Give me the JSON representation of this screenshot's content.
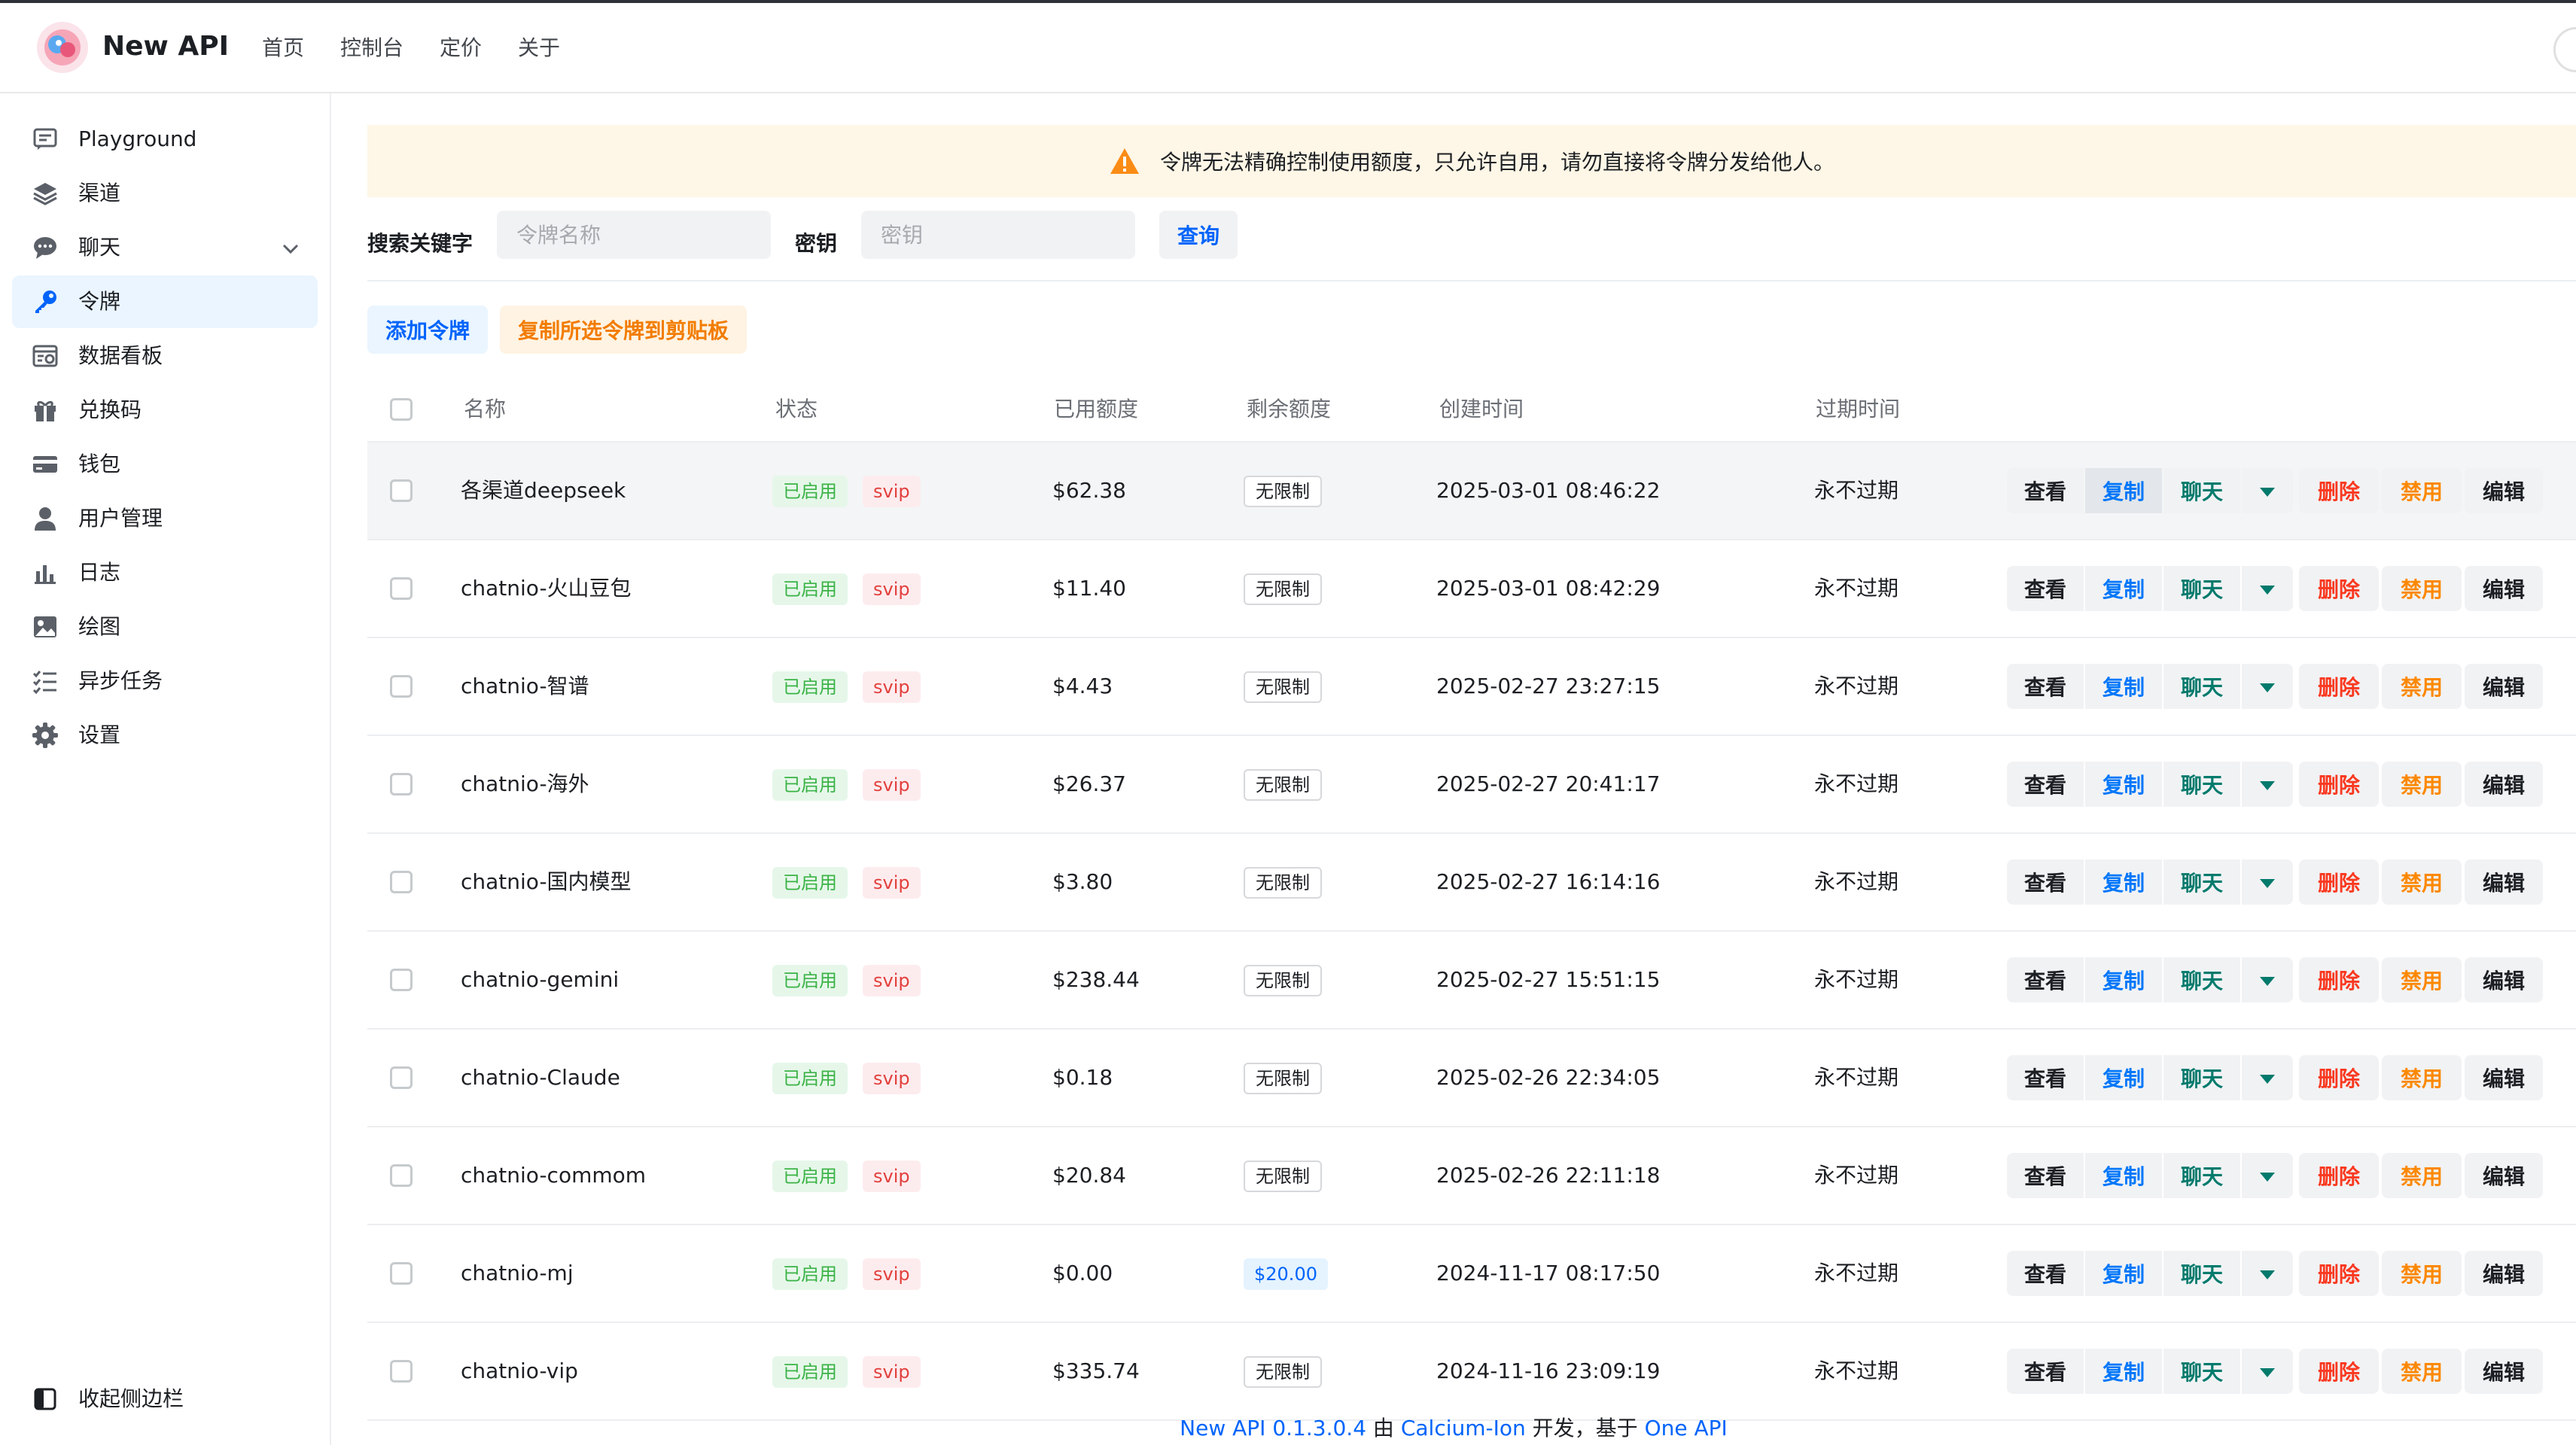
{
  "header": {
    "title": "New API",
    "nav": [
      "首页",
      "控制台",
      "定价",
      "关于"
    ]
  },
  "sidebar": {
    "items": [
      {
        "label": "Playground",
        "icon": "message-square-icon"
      },
      {
        "label": "渠道",
        "icon": "layers-icon"
      },
      {
        "label": "聊天",
        "icon": "chat-bubble-icon",
        "expandable": true
      },
      {
        "label": "令牌",
        "icon": "key-icon",
        "active": true
      },
      {
        "label": "数据看板",
        "icon": "dashboard-icon"
      },
      {
        "label": "兑换码",
        "icon": "gift-icon"
      },
      {
        "label": "钱包",
        "icon": "credit-card-icon"
      },
      {
        "label": "用户管理",
        "icon": "user-icon"
      },
      {
        "label": "日志",
        "icon": "bar-chart-icon"
      },
      {
        "label": "绘图",
        "icon": "image-icon"
      },
      {
        "label": "异步任务",
        "icon": "task-list-icon"
      },
      {
        "label": "设置",
        "icon": "gear-icon"
      }
    ],
    "collapse_label": "收起侧边栏"
  },
  "banner": {
    "text": "令牌无法精确控制使用额度，只允许自用，请勿直接将令牌分发给他人。"
  },
  "search": {
    "keyword_label": "搜索关键字",
    "name_placeholder": "令牌名称",
    "key_label": "密钥",
    "key_placeholder": "密钥",
    "query_label": "查询"
  },
  "toolbar": {
    "add_label": "添加令牌",
    "copy_selected_label": "复制所选令牌到剪贴板"
  },
  "table": {
    "columns": [
      "名称",
      "状态",
      "已用额度",
      "剩余额度",
      "创建时间",
      "过期时间"
    ],
    "actions": {
      "view": "查看",
      "copy": "复制",
      "chat": "聊天",
      "delete": "删除",
      "disable": "禁用",
      "edit": "编辑"
    },
    "rows": [
      {
        "name": "各渠道deepseek",
        "status": "已启用",
        "group": "svip",
        "used": "$62.38",
        "remain": "无限制",
        "created": "2025-03-01 08:46:22",
        "expires": "永不过期"
      },
      {
        "name": "chatnio-火山豆包",
        "status": "已启用",
        "group": "svip",
        "used": "$11.40",
        "remain": "无限制",
        "created": "2025-03-01 08:42:29",
        "expires": "永不过期"
      },
      {
        "name": "chatnio-智谱",
        "status": "已启用",
        "group": "svip",
        "used": "$4.43",
        "remain": "无限制",
        "created": "2025-02-27 23:27:15",
        "expires": "永不过期"
      },
      {
        "name": "chatnio-海外",
        "status": "已启用",
        "group": "svip",
        "used": "$26.37",
        "remain": "无限制",
        "created": "2025-02-27 20:41:17",
        "expires": "永不过期"
      },
      {
        "name": "chatnio-国内模型",
        "status": "已启用",
        "group": "svip",
        "used": "$3.80",
        "remain": "无限制",
        "created": "2025-02-27 16:14:16",
        "expires": "永不过期"
      },
      {
        "name": "chatnio-gemini",
        "status": "已启用",
        "group": "svip",
        "used": "$238.44",
        "remain": "无限制",
        "created": "2025-02-27 15:51:15",
        "expires": "永不过期"
      },
      {
        "name": "chatnio-Claude",
        "status": "已启用",
        "group": "svip",
        "used": "$0.18",
        "remain": "无限制",
        "created": "2025-02-26 22:34:05",
        "expires": "永不过期"
      },
      {
        "name": "chatnio-commom",
        "status": "已启用",
        "group": "svip",
        "used": "$20.84",
        "remain": "无限制",
        "created": "2025-02-26 22:11:18",
        "expires": "永不过期"
      },
      {
        "name": "chatnio-mj",
        "status": "已启用",
        "group": "svip",
        "used": "$0.00",
        "remain": "$20.00",
        "created": "2024-11-17 08:17:50",
        "expires": "永不过期"
      },
      {
        "name": "chatnio-vip",
        "status": "已启用",
        "group": "svip",
        "used": "$335.74",
        "remain": "无限制",
        "created": "2024-11-16 23:09:19",
        "expires": "永不过期"
      }
    ]
  },
  "footer": {
    "version_link": "New API 0.1.3.0.4",
    "by": "由",
    "author_link": "Calcium-Ion",
    "dev": "开发，基于",
    "base_link": "One API"
  },
  "colors": {
    "accent": "#0064fa",
    "active_bg": "#eaf5ff",
    "warning_bg": "#fef6e6",
    "warning_icon": "#fa8c16",
    "success": "#3bb346",
    "danger": "#f93920",
    "orange": "#fc8800",
    "teal": "#007a6c"
  }
}
